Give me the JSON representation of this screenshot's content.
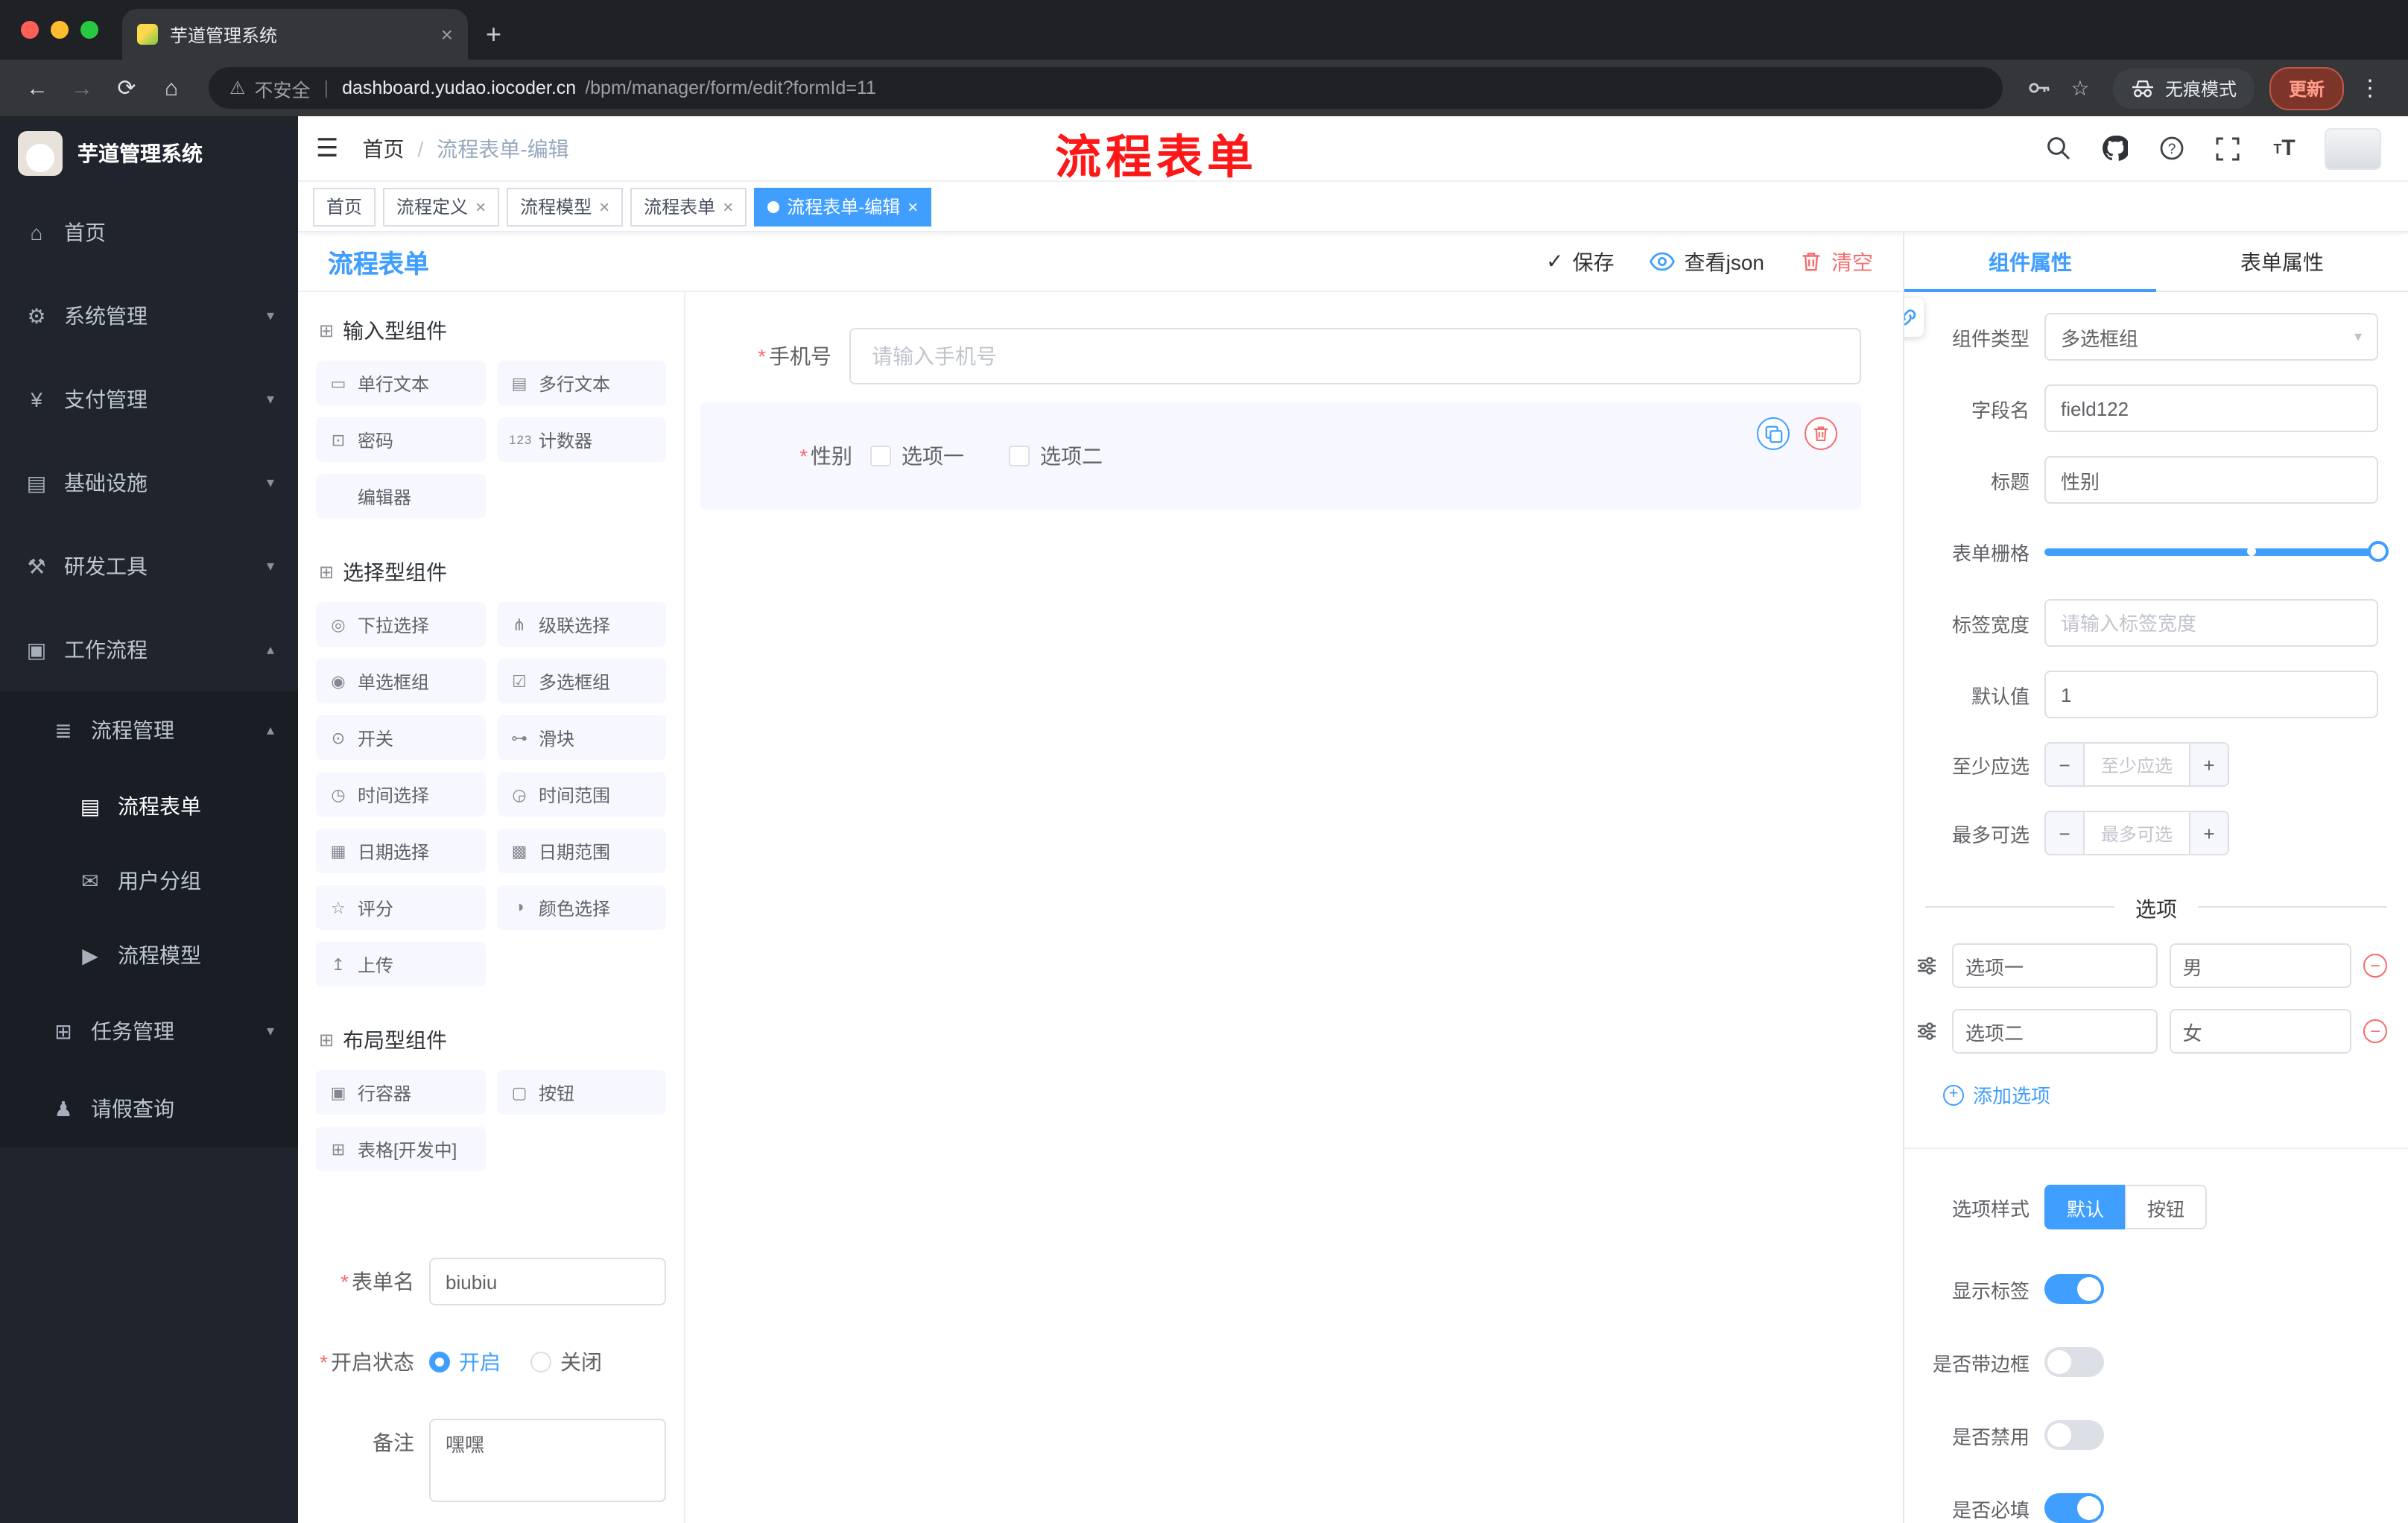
{
  "colors": {
    "primary": "#409eff",
    "danger": "#f56c6c",
    "annotation_red": "#fe1717",
    "sidebar_bg": "#20252d"
  },
  "icons": {
    "menu_fold": "☰",
    "back": "←",
    "forward": "→",
    "reload": "⟳",
    "home_nav": "⌂",
    "warning": "⚠",
    "star": "☆",
    "dots": "⋮",
    "plus": "+",
    "close": "×",
    "caret_down": "▾",
    "caret_up": "▴",
    "check": "✓",
    "minus": "−",
    "plus_sign": "+",
    "home": "⌂",
    "gear": "⚙",
    "yen": "¥",
    "monitor": "▤",
    "tools": "⚒",
    "suitcase": "▣",
    "list": "≣",
    "doc": "▤",
    "chat": "✉",
    "send": "▶",
    "tree": "⊞",
    "person": "♟",
    "section": "⊞",
    "single_text": "▭",
    "multi_text": "▤",
    "password": "⊡",
    "counter": "123",
    "select": "◎",
    "cascader": "⋔",
    "radio": "◉",
    "checkbox": "☑",
    "switch": "⊙",
    "slider": "⊶",
    "time": "◷",
    "time_range": "◶",
    "date": "▦",
    "date_range": "▩",
    "rate": "☆",
    "color": "◑",
    "upload": "↥",
    "row": "▣",
    "button": "▢",
    "table": "⊞",
    "text_size": "T"
  },
  "browser": {
    "tab_title": "芋道管理系统",
    "security_label": "不安全",
    "url_host": "dashboard.yudao.iocoder.cn",
    "url_path": "/bpm/manager/form/edit?formId=11",
    "incognito_label": "无痕模式",
    "update_label": "更新"
  },
  "sidebar": {
    "title": "芋道管理系统",
    "items": [
      {
        "label": "首页"
      },
      {
        "label": "系统管理"
      },
      {
        "label": "支付管理"
      },
      {
        "label": "基础设施"
      },
      {
        "label": "研发工具"
      },
      {
        "label": "工作流程"
      },
      {
        "label": "流程管理"
      },
      {
        "label": "流程表单"
      },
      {
        "label": "用户分组"
      },
      {
        "label": "流程模型"
      },
      {
        "label": "任务管理"
      },
      {
        "label": "请假查询"
      }
    ]
  },
  "header": {
    "breadcrumb": [
      "首页",
      "流程表单-编辑"
    ],
    "annotation": "流程表单"
  },
  "tags": [
    {
      "label": "首页",
      "active": false,
      "closable": false
    },
    {
      "label": "流程定义",
      "active": false,
      "closable": true
    },
    {
      "label": "流程模型",
      "active": false,
      "closable": true
    },
    {
      "label": "流程表单",
      "active": false,
      "closable": true
    },
    {
      "label": "流程表单-编辑",
      "active": true,
      "closable": true
    }
  ],
  "designer": {
    "title": "流程表单",
    "save": "保存",
    "view_json": "查看json",
    "clear": "清空",
    "palette": {
      "sections": [
        {
          "title": "输入型组件"
        },
        {
          "title": "选择型组件"
        },
        {
          "title": "布局型组件"
        }
      ],
      "input_items": [
        "单行文本",
        "多行文本",
        "密码",
        "计数器",
        "编辑器"
      ],
      "select_items": [
        "下拉选择",
        "级联选择",
        "单选框组",
        "多选框组",
        "开关",
        "滑块",
        "时间选择",
        "时间范围",
        "日期选择",
        "日期范围",
        "评分",
        "颜色选择",
        "上传"
      ],
      "layout_items": [
        "行容器",
        "按钮",
        "表格[开发中]"
      ]
    },
    "meta": {
      "form_name_label": "表单名",
      "form_name_value": "biubiu",
      "status_label": "开启状态",
      "status_on": "开启",
      "status_off": "关闭",
      "status_selected": "开启",
      "remark_label": "备注",
      "remark_value": "嘿嘿"
    },
    "canvas": {
      "phone_label": "手机号",
      "phone_placeholder": "请输入手机号",
      "gender_label": "性别",
      "gender_options": [
        "选项一",
        "选项二"
      ],
      "gender_checked": [
        false,
        false
      ]
    }
  },
  "props": {
    "tabs": [
      "组件属性",
      "表单属性"
    ],
    "active_tab": "组件属性",
    "component_type_label": "组件类型",
    "component_type_value": "多选框组",
    "field_name_label": "字段名",
    "field_name_value": "field122",
    "title_label": "标题",
    "title_value": "性别",
    "grid_label": "表单栅格",
    "grid_slider": {
      "handle_percent": 100,
      "stop_percent": 62
    },
    "label_width_label": "标签宽度",
    "label_width_placeholder": "请输入标签宽度",
    "default_label": "默认值",
    "default_value": "1",
    "min_label": "至少应选",
    "min_placeholder": "至少应选",
    "max_label": "最多可选",
    "max_placeholder": "最多可选",
    "options_title": "选项",
    "options": [
      {
        "name": "选项一",
        "value": "男"
      },
      {
        "name": "选项二",
        "value": "女"
      }
    ],
    "add_option": "添加选项",
    "style_label": "选项样式",
    "style_default": "默认",
    "style_button": "按钮",
    "style_selected": "默认",
    "show_label": "显示标签",
    "show_label_on": true,
    "border_label": "是否带边框",
    "border_on": false,
    "disabled_label": "是否禁用",
    "disabled_on": false,
    "required_label": "是否必填",
    "required_on": true
  }
}
